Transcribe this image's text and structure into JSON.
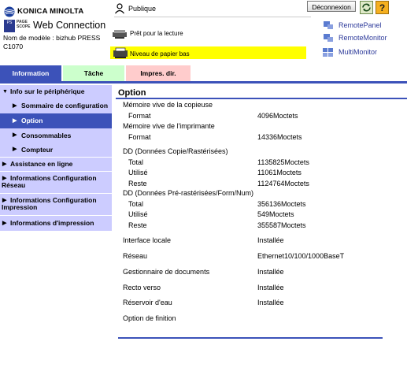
{
  "header": {
    "brand": "KONICA MINOLTA",
    "page_scope": "PAGE SCOPE",
    "product": "Web Connection",
    "model_line1": "Nom de modèle : bizhub PRESS",
    "model_line2": "C1070",
    "user_label": "Publique",
    "logout_label": "Déconnexion",
    "help_label": "?",
    "status_ready": "Prêt pour la lecture",
    "status_paper": "Niveau de papier bas",
    "remote_panel": "RemotePanel",
    "remote_monitor": "RemoteMonitor",
    "multi_monitor": "MultiMonitor"
  },
  "tabs": {
    "info": "Information",
    "tache": "Tâche",
    "impres": "Impres. dir."
  },
  "sidebar": {
    "items": [
      {
        "label": "Info sur le périphérique"
      },
      {
        "label": "Sommaire de configuration"
      },
      {
        "label": "Option"
      },
      {
        "label": "Consommables"
      },
      {
        "label": "Compteur"
      },
      {
        "label": "Assistance en ligne"
      },
      {
        "label1": "Informations Configuration",
        "label2": "Réseau"
      },
      {
        "label1": "Informations Configuration",
        "label2": "Impression"
      },
      {
        "label": "Informations d'impression"
      }
    ]
  },
  "content": {
    "title": "Option",
    "copier_mem": "Mémoire vive de la copieuse",
    "copier_fmt_label": "Format",
    "copier_fmt": "4096Moctets",
    "printer_mem": "Mémoire vive de l'imprimante",
    "printer_fmt_label": "Format",
    "printer_fmt": "14336Moctets",
    "hdd1": "DD (Données Copie/Rastérisées)",
    "hdd1_total_label": "Total",
    "hdd1_total": "1135825Moctets",
    "hdd1_used_label": "Utilisé",
    "hdd1_used": "11061Moctets",
    "hdd1_rest_label": "Reste",
    "hdd1_rest": "1124764Moctets",
    "hdd2": "DD (Données Pré-rastérisées/Form/Num)",
    "hdd2_total_label": "Total",
    "hdd2_total": "356136Moctets",
    "hdd2_used_label": "Utilisé",
    "hdd2_used": "549Moctets",
    "hdd2_rest_label": "Reste",
    "hdd2_rest": "355587Moctets",
    "local_if_label": "Interface locale",
    "local_if": "Installée",
    "network_label": "Réseau",
    "network": "Ethernet10/100/1000BaseT",
    "doc_mgr_label": "Gestionnaire de documents",
    "doc_mgr": "Installée",
    "duplex_label": "Recto verso",
    "duplex": "Installée",
    "water_label": "Réservoir d'eau",
    "water": "Installée",
    "finisher_label": "Option de finition"
  },
  "colors": {
    "accent": "#3c52b9",
    "side_bg": "#ccccff",
    "tab_task": "#ccffcc",
    "tab_print": "#ffcccc",
    "warn": "#ffff00"
  }
}
